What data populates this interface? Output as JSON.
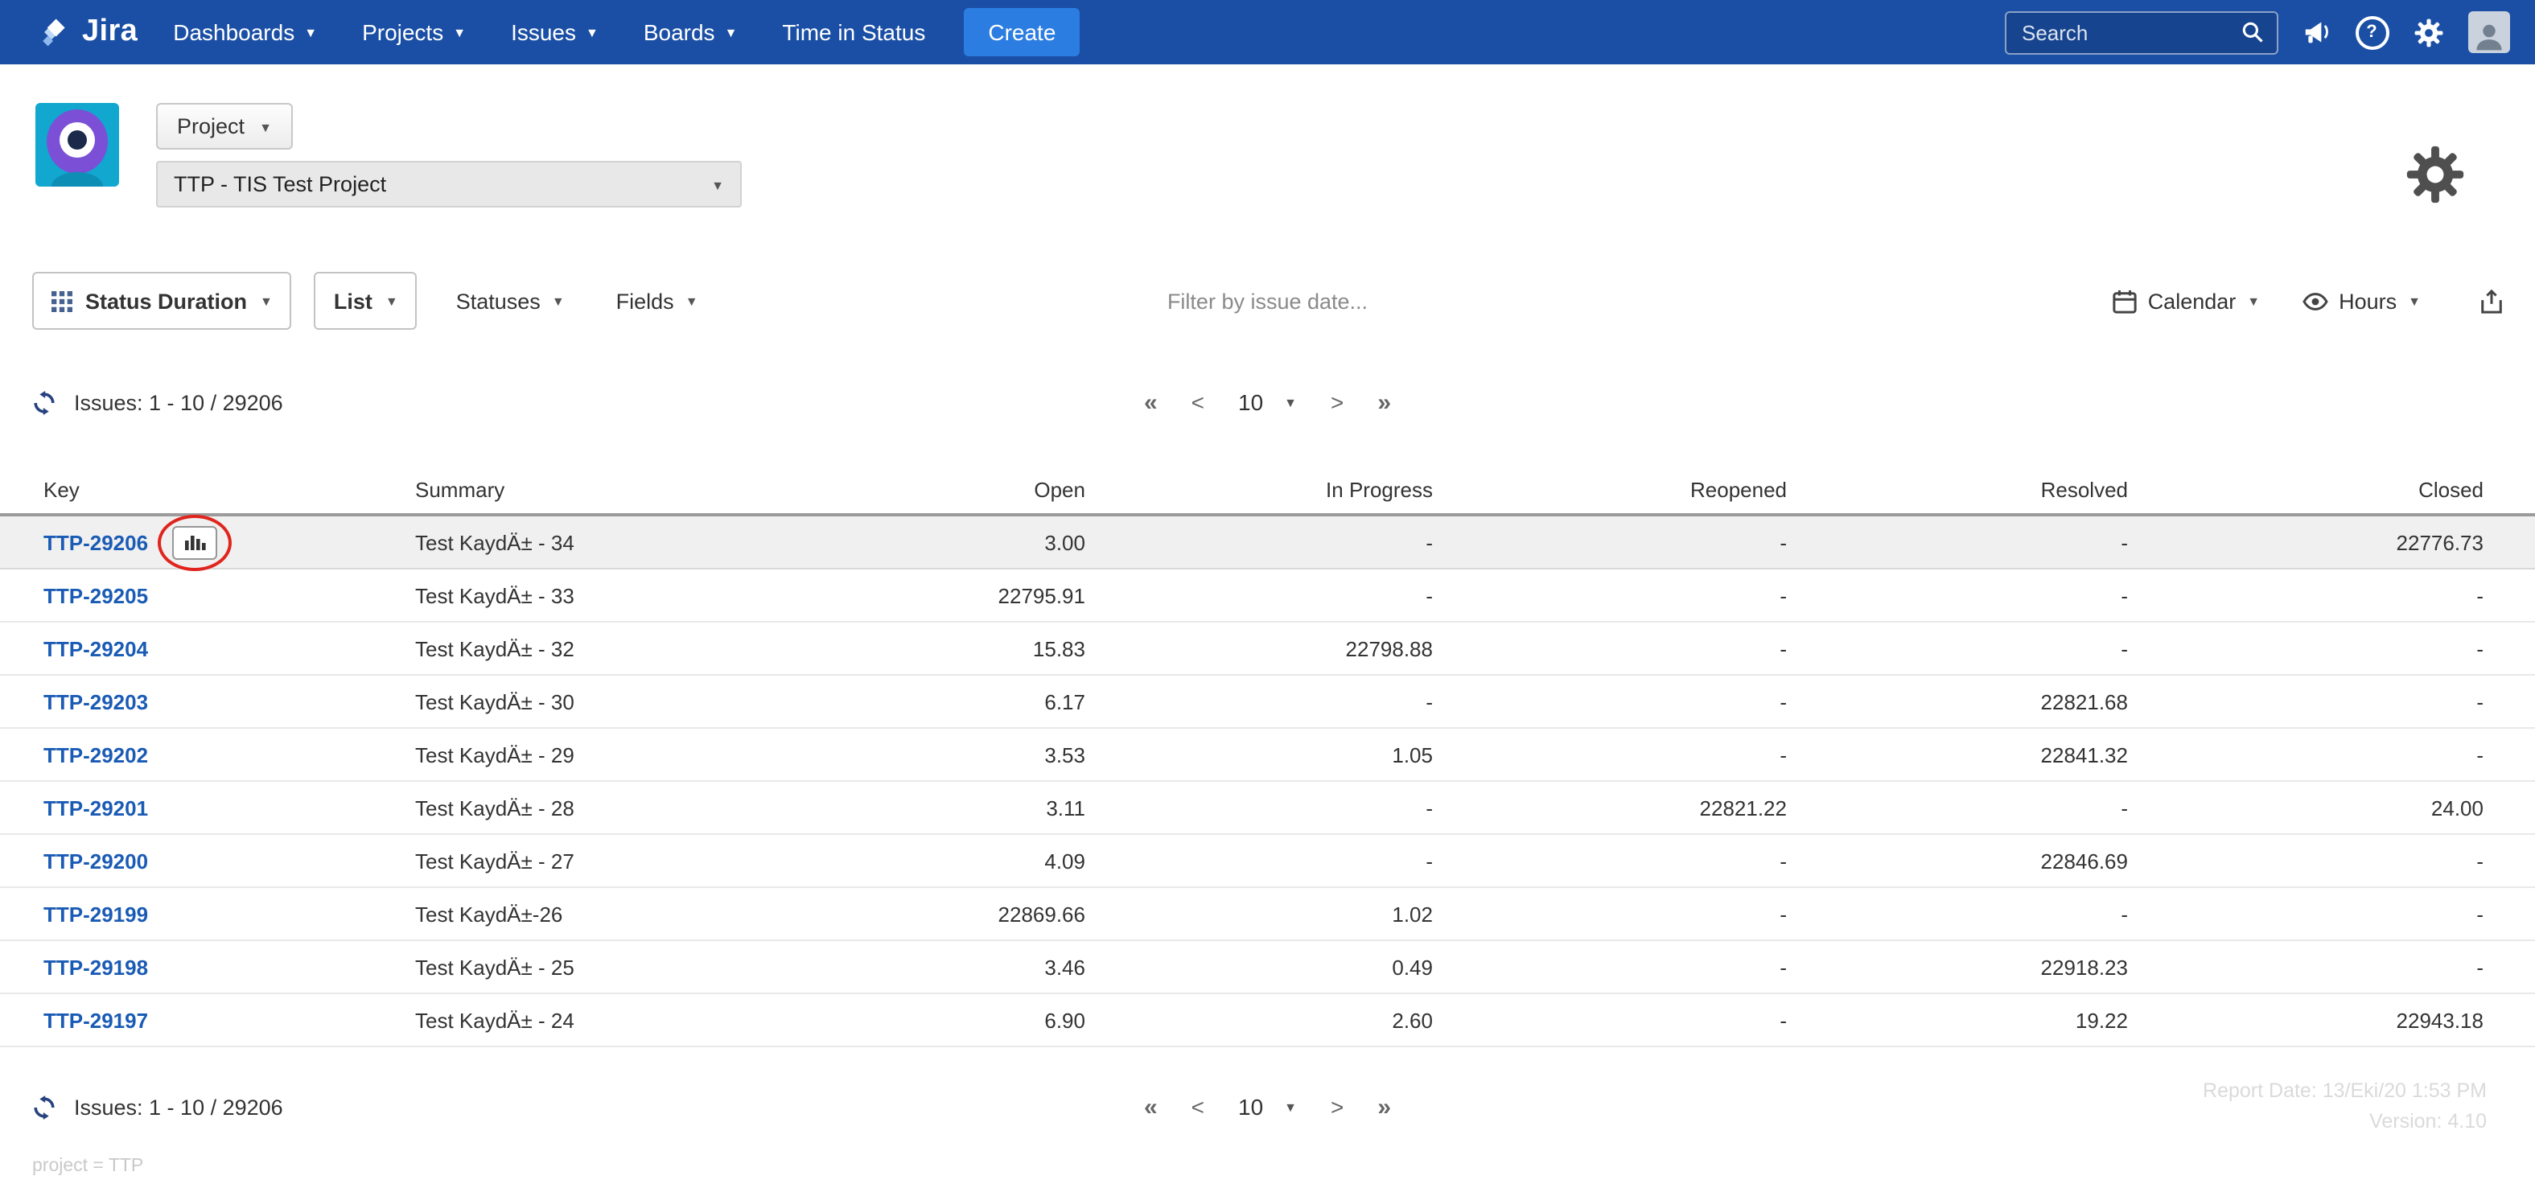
{
  "colors": {
    "nav_bg": "#1a4fa5",
    "create_button_bg": "#2b7de1",
    "link_blue": "#1a5bb5",
    "row_highlight": "#f0f0f0",
    "annotation_red": "#e0251e"
  },
  "nav": {
    "brand": "Jira",
    "items": [
      {
        "label": "Dashboards"
      },
      {
        "label": "Projects"
      },
      {
        "label": "Issues"
      },
      {
        "label": "Boards"
      },
      {
        "label": "Time in Status"
      }
    ],
    "create_label": "Create",
    "search_placeholder": "Search"
  },
  "project_header": {
    "project_button_label": "Project",
    "selected_project": "TTP - TIS Test Project"
  },
  "toolbar": {
    "report_type_label": "Status Duration",
    "view_label": "List",
    "statuses_label": "Statuses",
    "fields_label": "Fields",
    "filter_placeholder": "Filter by issue date...",
    "calendar_label": "Calendar",
    "unit_label": "Hours"
  },
  "pagination": {
    "issues_label": "Issues: 1 - 10 / 29206",
    "first": "«",
    "prev": "<",
    "page_size": "10",
    "next": ">",
    "last": "»"
  },
  "table": {
    "columns": [
      "Key",
      "Summary",
      "Open",
      "In Progress",
      "Reopened",
      "Resolved",
      "Closed"
    ],
    "rows": [
      {
        "key": "TTP-29206",
        "summary": "Test KaydÄ± - 34",
        "open": "3.00",
        "in_progress": "-",
        "reopened": "-",
        "resolved": "-",
        "closed": "22776.73",
        "has_chart_button": true,
        "highlighted": true
      },
      {
        "key": "TTP-29205",
        "summary": "Test KaydÄ± - 33",
        "open": "22795.91",
        "in_progress": "-",
        "reopened": "-",
        "resolved": "-",
        "closed": "-"
      },
      {
        "key": "TTP-29204",
        "summary": "Test KaydÄ± - 32",
        "open": "15.83",
        "in_progress": "22798.88",
        "reopened": "-",
        "resolved": "-",
        "closed": "-"
      },
      {
        "key": "TTP-29203",
        "summary": "Test KaydÄ± - 30",
        "open": "6.17",
        "in_progress": "-",
        "reopened": "-",
        "resolved": "22821.68",
        "closed": "-"
      },
      {
        "key": "TTP-29202",
        "summary": "Test KaydÄ± - 29",
        "open": "3.53",
        "in_progress": "1.05",
        "reopened": "-",
        "resolved": "22841.32",
        "closed": "-"
      },
      {
        "key": "TTP-29201",
        "summary": "Test KaydÄ± - 28",
        "open": "3.11",
        "in_progress": "-",
        "reopened": "22821.22",
        "resolved": "-",
        "closed": "24.00"
      },
      {
        "key": "TTP-29200",
        "summary": "Test KaydÄ± - 27",
        "open": "4.09",
        "in_progress": "-",
        "reopened": "-",
        "resolved": "22846.69",
        "closed": "-"
      },
      {
        "key": "TTP-29199",
        "summary": "Test KaydÄ±-26",
        "open": "22869.66",
        "in_progress": "1.02",
        "reopened": "-",
        "resolved": "-",
        "closed": "-"
      },
      {
        "key": "TTP-29198",
        "summary": "Test KaydÄ± - 25",
        "open": "3.46",
        "in_progress": "0.49",
        "reopened": "-",
        "resolved": "22918.23",
        "closed": "-"
      },
      {
        "key": "TTP-29197",
        "summary": "Test KaydÄ± - 24",
        "open": "6.90",
        "in_progress": "2.60",
        "reopened": "-",
        "resolved": "19.22",
        "closed": "22943.18"
      }
    ]
  },
  "footer": {
    "report_date": "Report Date: 13/Eki/20 1:53 PM",
    "version": "Version: 4.10",
    "query": "project = TTP"
  },
  "icons": {
    "search": "magnifier",
    "feedback": "megaphone",
    "help": "question-circle",
    "settings": "gear",
    "refresh": "circular-arrows",
    "report_type": "grid-3x3",
    "calendar": "calendar",
    "hours": "eye",
    "export": "share-up-arrow",
    "row_chart": "bar-chart"
  }
}
